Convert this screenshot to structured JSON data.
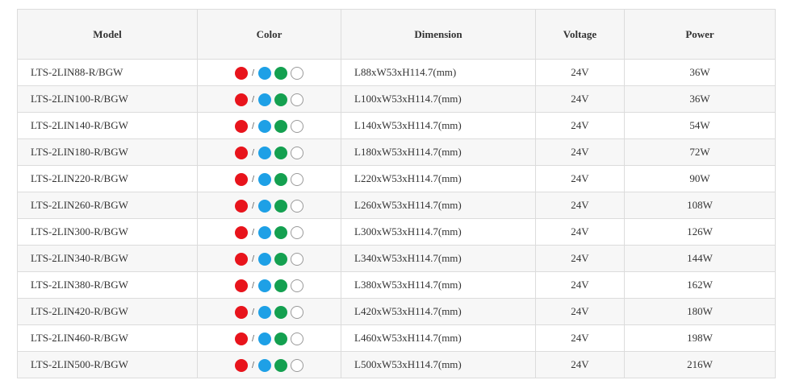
{
  "table": {
    "headers": [
      "Model",
      "Color",
      "Dimension",
      "Voltage",
      "Power"
    ],
    "swatch_separator": "/",
    "swatch_colors": {
      "red": "#e8141c",
      "blue": "#1ea0e6",
      "green": "#14a050",
      "white": "#ffffff"
    },
    "rows": [
      {
        "model": "LTS-2LIN88-R/BGW",
        "dimension": "L88xW53xH114.7(mm)",
        "voltage": "24V",
        "power": "36W"
      },
      {
        "model": "LTS-2LIN100-R/BGW",
        "dimension": "L100xW53xH114.7(mm)",
        "voltage": "24V",
        "power": "36W"
      },
      {
        "model": "LTS-2LIN140-R/BGW",
        "dimension": "L140xW53xH114.7(mm)",
        "voltage": "24V",
        "power": "54W"
      },
      {
        "model": "LTS-2LIN180-R/BGW",
        "dimension": "L180xW53xH114.7(mm)",
        "voltage": "24V",
        "power": "72W"
      },
      {
        "model": "LTS-2LIN220-R/BGW",
        "dimension": "L220xW53xH114.7(mm)",
        "voltage": "24V",
        "power": "90W"
      },
      {
        "model": "LTS-2LIN260-R/BGW",
        "dimension": "L260xW53xH114.7(mm)",
        "voltage": "24V",
        "power": "108W"
      },
      {
        "model": "LTS-2LIN300-R/BGW",
        "dimension": "L300xW53xH114.7(mm)",
        "voltage": "24V",
        "power": "126W"
      },
      {
        "model": "LTS-2LIN340-R/BGW",
        "dimension": "L340xW53xH114.7(mm)",
        "voltage": "24V",
        "power": "144W"
      },
      {
        "model": "LTS-2LIN380-R/BGW",
        "dimension": "L380xW53xH114.7(mm)",
        "voltage": "24V",
        "power": "162W"
      },
      {
        "model": "LTS-2LIN420-R/BGW",
        "dimension": "L420xW53xH114.7(mm)",
        "voltage": "24V",
        "power": "180W"
      },
      {
        "model": "LTS-2LIN460-R/BGW",
        "dimension": "L460xW53xH114.7(mm)",
        "voltage": "24V",
        "power": "198W"
      },
      {
        "model": "LTS-2LIN500-R/BGW",
        "dimension": "L500xW53xH114.7(mm)",
        "voltage": "24V",
        "power": "216W"
      }
    ]
  }
}
